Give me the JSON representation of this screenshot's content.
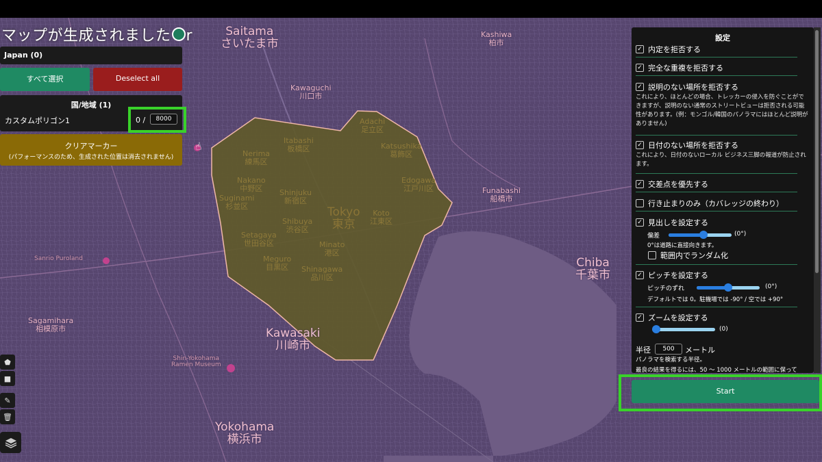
{
  "app": {
    "title_part1": "マップが生成されました",
    "title_part2": "r"
  },
  "left_panel": {
    "country": "Japan (0)",
    "select_all": "すべて選択",
    "deselect_all": "Deselect all",
    "region_header": "国/地域 (1)",
    "polygon_name": "カスタムポリゴン1",
    "generated": "0 /",
    "target": "8000",
    "clear_marker": "クリアマーカー",
    "clear_marker_note": "(パフォーマンスのため、生成された位置は消去されません)"
  },
  "settings": {
    "title": "設定",
    "options": {
      "reject_inside": {
        "label": "内定を拒否する",
        "checked": true
      },
      "reject_dup": {
        "label": "完全な重複を拒否する",
        "checked": true
      },
      "reject_nodesc": {
        "label": "説明のない場所を拒否する",
        "checked": true,
        "desc": "これにより、ほとんどの場合、トレッカーの侵入を防ぐことができますが、説明のない通常のストリートビューは拒否される可能性があります。(例：モンゴル/韓国のパノラマにはほとんど説明がありません)"
      },
      "reject_nodate": {
        "label": "日付のない場所を拒否する",
        "checked": true,
        "desc": "これにより、日付のないローカル ビジネス三脚の報道が防止されます。"
      },
      "prefer_intersections": {
        "label": "交差点を優先する",
        "checked": true
      },
      "dead_ends": {
        "label": "行き止まりのみ（カバレッジの終わり）",
        "checked": false
      },
      "heading": {
        "label": "見出しを設定する",
        "checked": true,
        "deviation_label": "偏差",
        "deviation_value": "(0°)",
        "deviation_level": 0.55,
        "note": "0°は道路に直接向きます。",
        "random_label": "範囲内でランダム化",
        "random_checked": false
      },
      "pitch": {
        "label": "ピッチを設定する",
        "checked": true,
        "offset_label": "ピッチのずれ",
        "offset_value": "(0°)",
        "offset_level": 0.5,
        "note": "デフォルトでは 0。駐機場では -90° / 空では +90°"
      },
      "zoom": {
        "label": "ズームを設定する",
        "checked": true,
        "value": "(0)",
        "level": 0.0
      }
    },
    "radius": {
      "label": "半径",
      "value": "500",
      "unit": "メートル",
      "desc1": "パノラマを検索する半径。",
      "desc2": "最良の結果を得るには、50 ～ 1000 メートルの範囲に保って"
    },
    "start": "Start"
  },
  "map": {
    "labels": {
      "saitama": "Saitama",
      "saitama_jp": "さいたま市",
      "kawaguchi": "Kawaguchi",
      "kawaguchi_jp": "川口市",
      "kashiwa": "Kashiwa",
      "kashiwa_jp": "柏市",
      "funabashi": "Funabashi",
      "funabashi_jp": "船橋市",
      "chiba": "Chiba",
      "chiba_jp": "千葉市",
      "tokyo": "Tokyo",
      "tokyo_jp": "東京",
      "kawasaki": "Kawasaki",
      "kawasaki_jp": "川崎市",
      "yokohama": "Yokohama",
      "yokohama_jp": "横浜市",
      "sagamihara": "Sagamihara",
      "sagamihara_jp": "相模原市",
      "nerima": "Nerima",
      "nerima_jp": "練馬区",
      "itabashi": "Itabashi",
      "itabashi_jp": "板橋区",
      "adachi": "Adachi",
      "adachi_jp": "足立区",
      "katsushika": "Katsushika",
      "katsushika_jp": "葛飾区",
      "edogawa": "Edogawa",
      "edogawa_jp": "江戸川区",
      "nakano": "Nakano",
      "nakano_jp": "中野区",
      "shinjuku": "Shinjuku",
      "shinjuku_jp": "新宿区",
      "suginami": "Suginami",
      "suginami_jp": "杉並区",
      "shibuya": "Shibuya",
      "shibuya_jp": "渋谷区",
      "koto": "Koto",
      "koto_jp": "江東区",
      "setagaya": "Setagaya",
      "setagaya_jp": "世田谷区",
      "minato": "Minato",
      "minato_jp": "港区",
      "meguro": "Meguro",
      "meguro_jp": "目黒区",
      "shinagawa": "Shinagawa",
      "shinagawa_jp": "品川区",
      "sanrio": "Sanrio Puroland",
      "shinyokohama": "Shin-Yokohama",
      "ramen": "Ramen Museum"
    }
  },
  "colors": {
    "map_bg": "#5a4a78",
    "polygon_fill": "#5f5a2a",
    "polygon_stroke": "#f0b8a8",
    "water": "#6e5c84",
    "highlight": "#39d22a",
    "accent": "#1f8a63",
    "danger": "#9a1d1d",
    "warning": "#8a6a06"
  },
  "icons": [
    "globe-icon",
    "cursor-icon",
    "polygon-tool-icon",
    "rectangle-tool-icon",
    "edit-icon",
    "trash-icon",
    "layers-icon",
    "check-icon"
  ]
}
